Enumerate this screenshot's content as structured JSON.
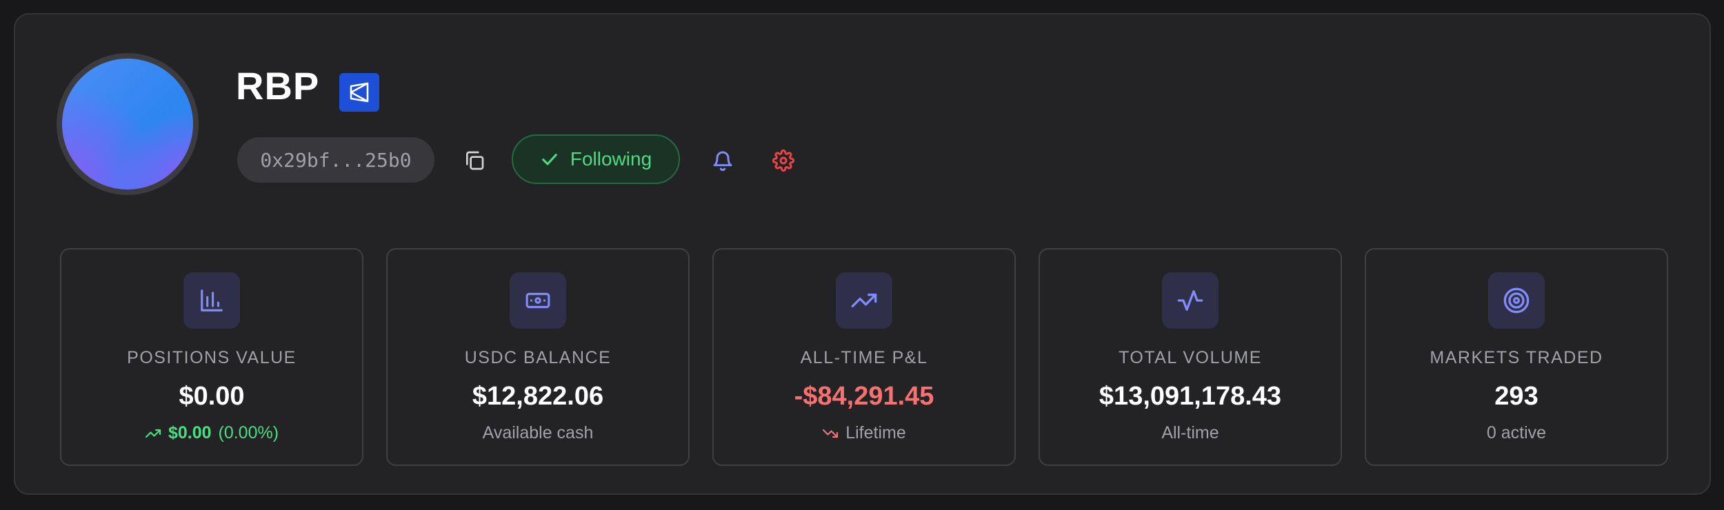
{
  "profile": {
    "username": "RBP",
    "address": "0x29bf...25b0",
    "follow_label": "Following"
  },
  "colors": {
    "positive": "#4ade80",
    "negative": "#f87171",
    "accent": "#818cf8",
    "badge": "#1d4fd8",
    "settings": "#ef4444"
  },
  "stats": [
    {
      "icon": "bar-chart-icon",
      "label": "POSITIONS VALUE",
      "value": "$0.00",
      "change_value": "$0.00",
      "change_pct": "(0.00%)"
    },
    {
      "icon": "banknote-icon",
      "label": "USDC BALANCE",
      "value": "$12,822.06",
      "sub": "Available cash"
    },
    {
      "icon": "trending-up-icon",
      "label": "ALL-TIME P&L",
      "value": "-$84,291.45",
      "sub": "Lifetime"
    },
    {
      "icon": "activity-icon",
      "label": "TOTAL VOLUME",
      "value": "$13,091,178.43",
      "sub": "All-time"
    },
    {
      "icon": "target-icon",
      "label": "MARKETS TRADED",
      "value": "293",
      "sub": "0 active"
    }
  ]
}
